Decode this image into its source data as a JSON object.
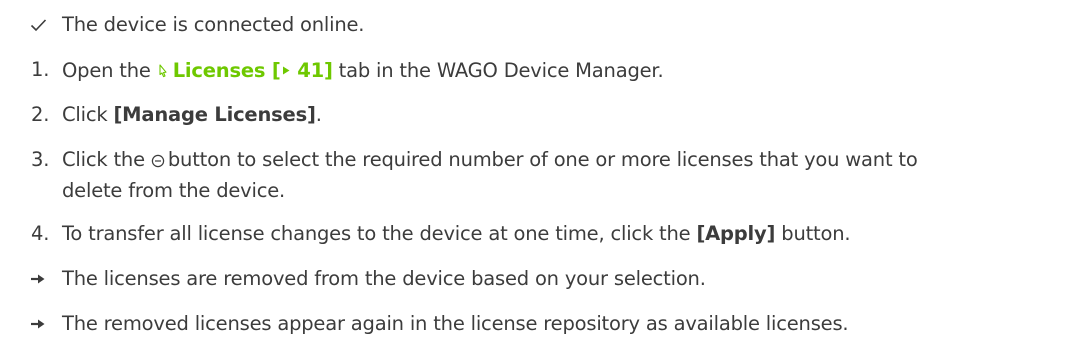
{
  "precondition": {
    "text": "The device is connected online."
  },
  "steps": [
    {
      "number": "1.",
      "pre": "Open the",
      "link_label": "Licenses [",
      "link_page": "41",
      "link_close": "]",
      "post": "tab in the WAGO Device Manager."
    },
    {
      "number": "2.",
      "pre": "Click",
      "bold": "[Manage Licenses]",
      "post": "."
    },
    {
      "number": "3.",
      "pre": "Click the",
      "post": "button to select the required number of one or more licenses that you want to",
      "line2": "delete from the device."
    },
    {
      "number": "4.",
      "pre": "To transfer all license changes to the device at one time, click the",
      "bold": "[Apply]",
      "post": "button."
    }
  ],
  "results": [
    {
      "text": "The licenses are removed from the device based on your selection."
    },
    {
      "text": "The removed licenses appear again in the license repository as available licenses."
    }
  ],
  "colors": {
    "text": "#3c3c3c",
    "link": "#6ec800"
  },
  "icons": {
    "precondition": "checkmark-icon",
    "link": "mouse-pointer-icon",
    "page_ref": "triangle-right-icon",
    "remove_button": "minus-circle-icon",
    "result": "arrow-right-icon"
  }
}
